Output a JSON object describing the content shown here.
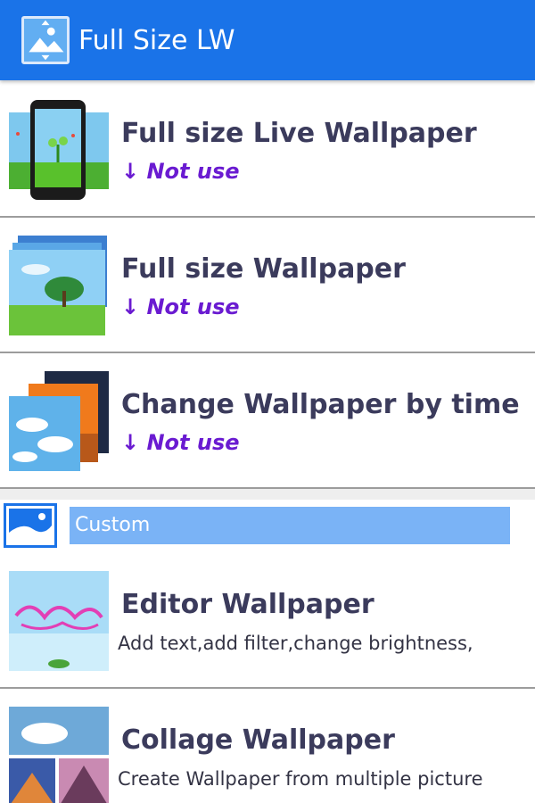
{
  "header": {
    "title": "Full Size LW",
    "icon": "image-frame-icon",
    "background_color": "#1a73e8"
  },
  "items": [
    {
      "title": "Full size Live Wallpaper",
      "status": "↓ Not use",
      "icon": "phone-wallpaper-icon"
    },
    {
      "title": "Full size Wallpaper",
      "status": "↓ Not use",
      "icon": "landscape-stack-icon"
    },
    {
      "title": "Change Wallpaper by time",
      "status": "↓ Not use",
      "icon": "sky-sunset-stack-icon"
    }
  ],
  "section": {
    "label": "Custom",
    "icon": "picture-icon",
    "label_background": "#7ab3f6"
  },
  "custom_items": [
    {
      "title": "Editor Wallpaper",
      "description": "Add text,add filter,change brightness,",
      "icon": "blue-sky-text-icon"
    },
    {
      "title": "Collage Wallpaper",
      "description": "Create Wallpaper from multiple picture",
      "icon": "collage-icon"
    }
  ],
  "colors": {
    "status_text": "#6a1bd1",
    "title_text": "#3b3b5c",
    "divider": "#9c9c9c"
  }
}
